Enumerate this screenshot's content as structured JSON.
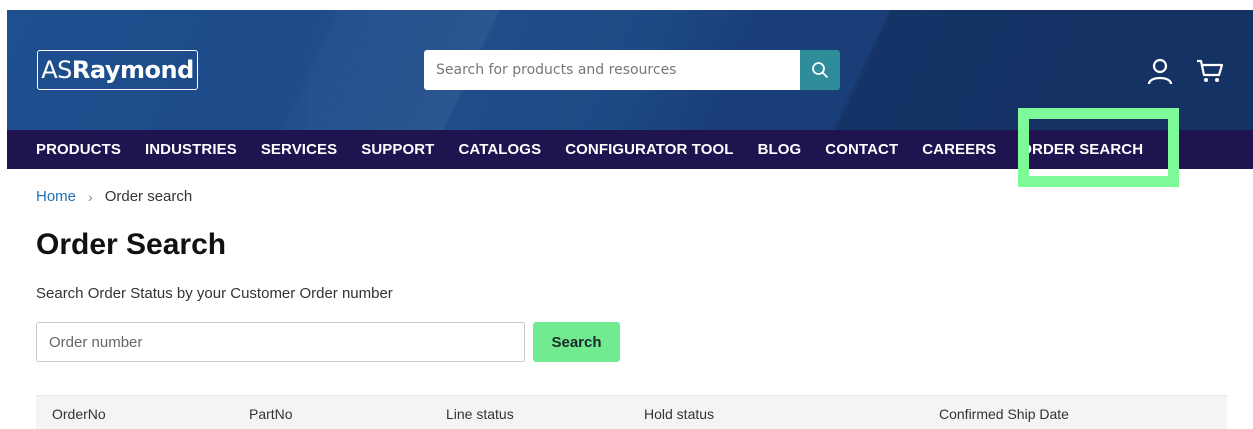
{
  "header": {
    "logo": {
      "part1": "AS",
      "part2": "Raymond"
    },
    "search": {
      "placeholder": "Search for products and resources"
    }
  },
  "nav": {
    "items": [
      "PRODUCTS",
      "INDUSTRIES",
      "SERVICES",
      "SUPPORT",
      "CATALOGS",
      "CONFIGURATOR TOOL",
      "BLOG",
      "CONTACT",
      "CAREERS",
      "ORDER SEARCH"
    ]
  },
  "breadcrumb": {
    "home": "Home",
    "separator": "›",
    "current": "Order search"
  },
  "main": {
    "title": "Order Search",
    "subtitle": "Search Order Status by your Customer Order number",
    "order_input_placeholder": "Order number",
    "search_button": "Search"
  },
  "table": {
    "columns": [
      "OrderNo",
      "PartNo",
      "Line status",
      "Hold status",
      "Confirmed Ship Date"
    ]
  },
  "colors": {
    "header_blue": "#1e4b89",
    "nav_dark": "#1f1350",
    "search_teal": "#2f8d9a",
    "button_green": "#72ea90",
    "highlight_green": "#7dfb98",
    "link_blue": "#1f6fb5"
  },
  "icons": {
    "search": "search-icon",
    "account": "user-icon",
    "cart": "cart-icon"
  }
}
